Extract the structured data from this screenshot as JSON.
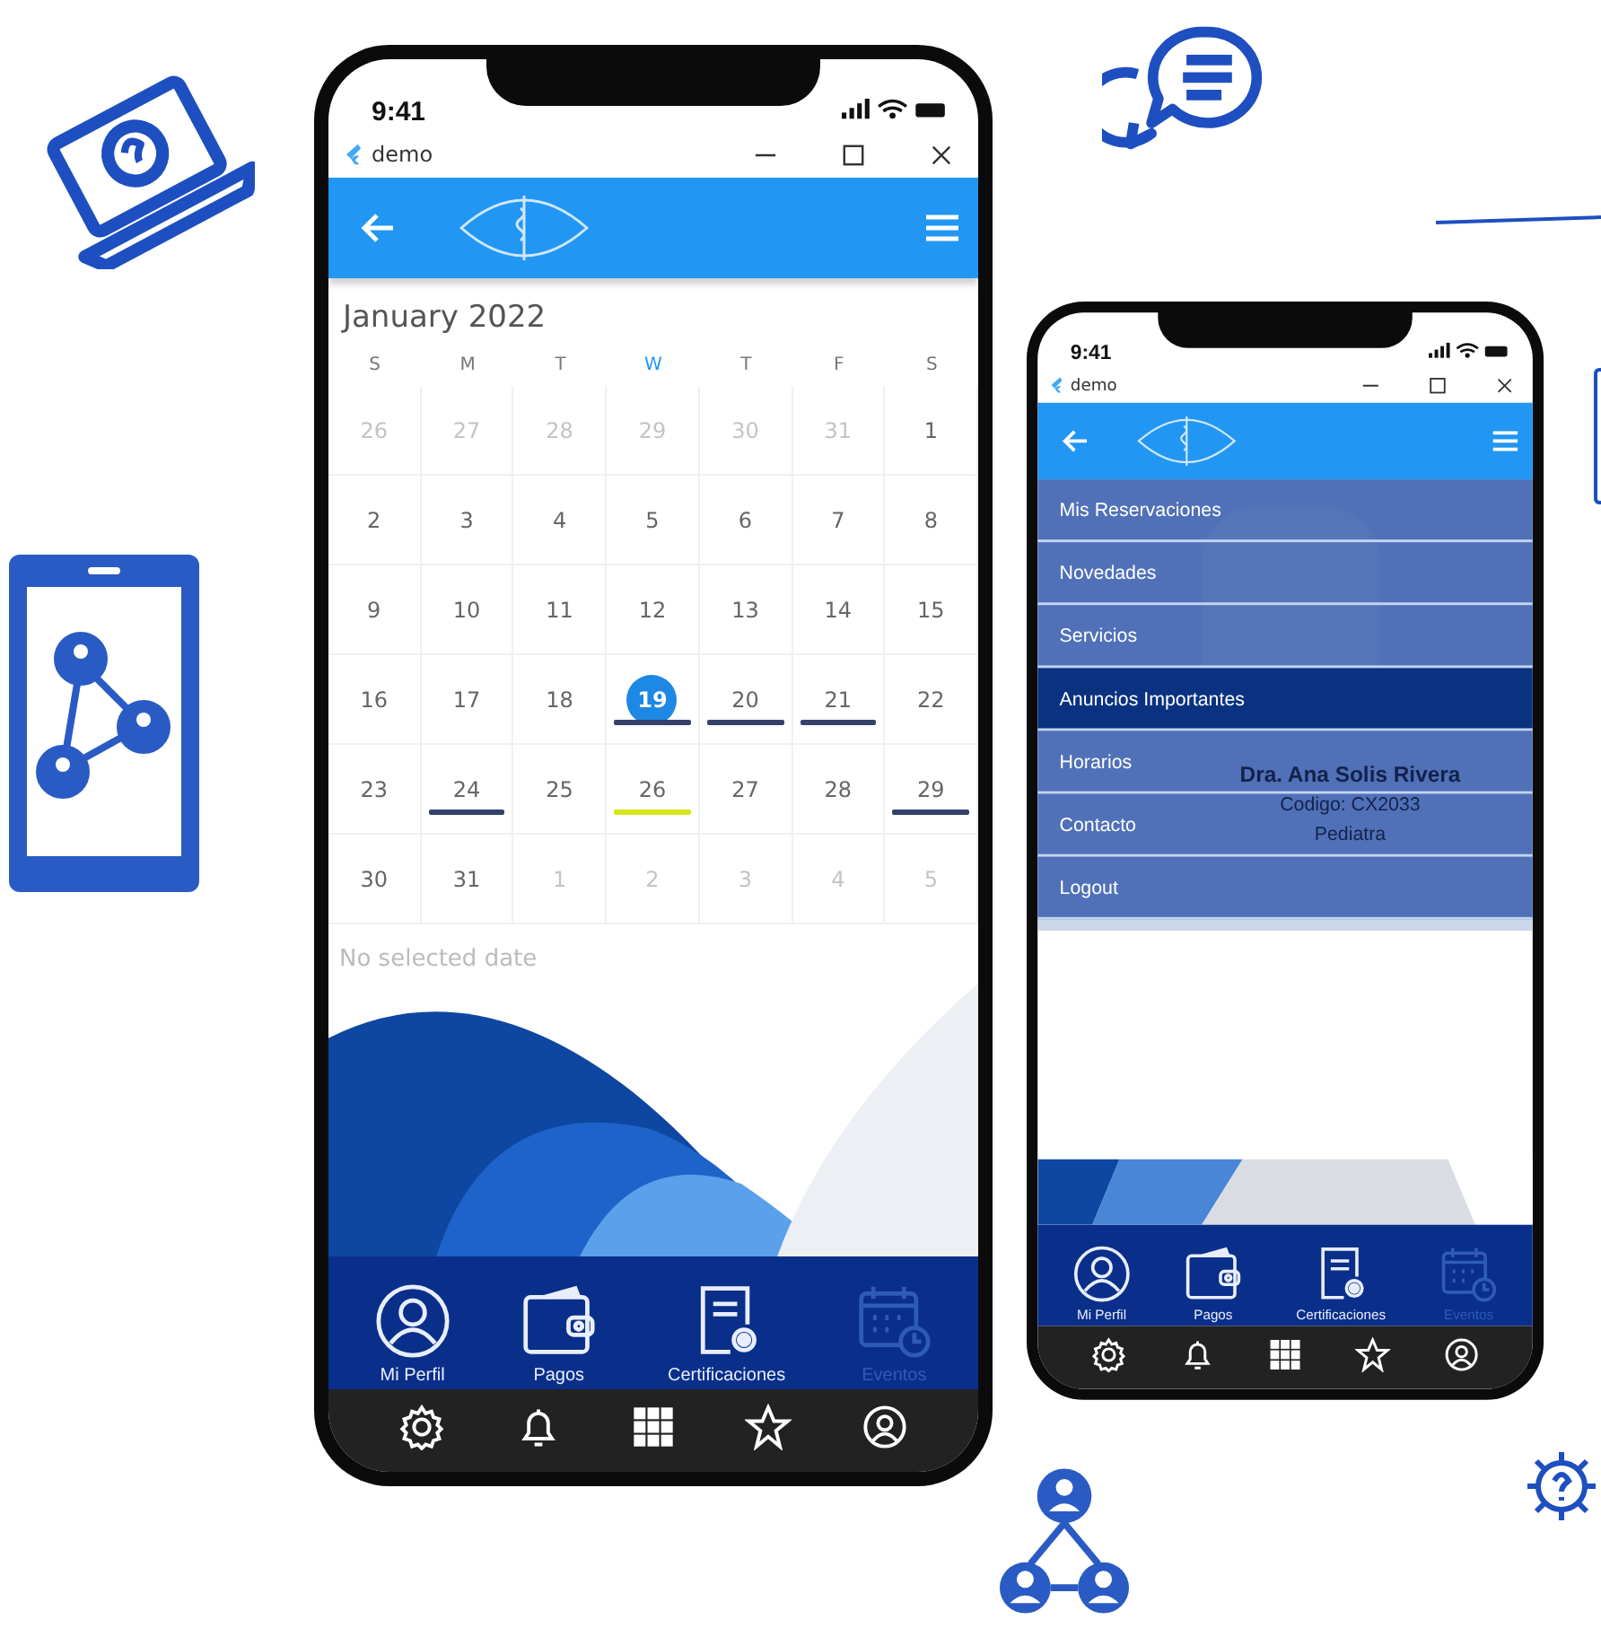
{
  "phones": [
    {
      "kind": "calendar",
      "status_time": "9:41",
      "window_title": "demo",
      "calendar": {
        "month_title": "January 2022",
        "weekdays": [
          {
            "label": "S",
            "today": false
          },
          {
            "label": "M",
            "today": false
          },
          {
            "label": "T",
            "today": false
          },
          {
            "label": "W",
            "today": true
          },
          {
            "label": "T",
            "today": false
          },
          {
            "label": "F",
            "today": false
          },
          {
            "label": "S",
            "today": false
          }
        ],
        "weeks": [
          [
            {
              "day": "26",
              "in_month": false,
              "selected": false
            },
            {
              "day": "27",
              "in_month": false,
              "selected": false
            },
            {
              "day": "28",
              "in_month": false,
              "selected": false
            },
            {
              "day": "29",
              "in_month": false,
              "selected": false
            },
            {
              "day": "30",
              "in_month": false,
              "selected": false
            },
            {
              "day": "31",
              "in_month": false,
              "selected": false
            },
            {
              "day": "1",
              "in_month": true,
              "selected": false
            }
          ],
          [
            {
              "day": "2",
              "in_month": true,
              "selected": false
            },
            {
              "day": "3",
              "in_month": true,
              "selected": false
            },
            {
              "day": "4",
              "in_month": true,
              "selected": false
            },
            {
              "day": "5",
              "in_month": true,
              "selected": false
            },
            {
              "day": "6",
              "in_month": true,
              "selected": false
            },
            {
              "day": "7",
              "in_month": true,
              "selected": false
            },
            {
              "day": "8",
              "in_month": true,
              "selected": false
            }
          ],
          [
            {
              "day": "9",
              "in_month": true,
              "selected": false
            },
            {
              "day": "10",
              "in_month": true,
              "selected": false
            },
            {
              "day": "11",
              "in_month": true,
              "selected": false
            },
            {
              "day": "12",
              "in_month": true,
              "selected": false
            },
            {
              "day": "13",
              "in_month": true,
              "selected": false
            },
            {
              "day": "14",
              "in_month": true,
              "selected": false
            },
            {
              "day": "15",
              "in_month": true,
              "selected": false
            }
          ],
          [
            {
              "day": "16",
              "in_month": true,
              "selected": false
            },
            {
              "day": "17",
              "in_month": true,
              "selected": false
            },
            {
              "day": "18",
              "in_month": true,
              "selected": false
            },
            {
              "day": "19",
              "in_month": true,
              "selected": true,
              "color": "#34416b"
            },
            {
              "day": "20",
              "in_month": true,
              "selected": false,
              "color": "#34416b"
            },
            {
              "day": "21",
              "in_month": true,
              "selected": false,
              "color": "#34416b"
            },
            {
              "day": "22",
              "in_month": true,
              "selected": false
            }
          ],
          [
            {
              "day": "23",
              "in_month": true,
              "selected": false
            },
            {
              "day": "24",
              "in_month": true,
              "selected": false,
              "color": "#34416b"
            },
            {
              "day": "25",
              "in_month": true,
              "selected": false
            },
            {
              "day": "26",
              "in_month": true,
              "selected": false,
              "color": "#d4e61b"
            },
            {
              "day": "27",
              "in_month": true,
              "selected": false
            },
            {
              "day": "28",
              "in_month": true,
              "selected": false
            },
            {
              "day": "29",
              "in_month": true,
              "selected": false,
              "color": "#34416b"
            }
          ],
          [
            {
              "day": "30",
              "in_month": true,
              "selected": false
            },
            {
              "day": "31",
              "in_month": true,
              "selected": false
            },
            {
              "day": "1",
              "in_month": false,
              "selected": false
            },
            {
              "day": "2",
              "in_month": false,
              "selected": false
            },
            {
              "day": "3",
              "in_month": false,
              "selected": false
            },
            {
              "day": "4",
              "in_month": false,
              "selected": false
            },
            {
              "day": "5",
              "in_month": false,
              "selected": false
            }
          ]
        ],
        "empty_message": "No selected date"
      },
      "bottom_tabs": [
        {
          "label": "Mi Perfil",
          "selected": false
        },
        {
          "label": "Pagos",
          "selected": false
        },
        {
          "label": "Certificaciones",
          "selected": false
        },
        {
          "label": "Eventos",
          "selected": true
        }
      ]
    },
    {
      "kind": "menu",
      "status_time": "9:41",
      "window_title": "demo",
      "menu": [
        {
          "label": "Mis Reservaciones",
          "selected": false
        },
        {
          "label": "Novedades",
          "selected": false
        },
        {
          "label": "Servicios",
          "selected": false
        },
        {
          "label": "Anuncios Importantes",
          "selected": true
        },
        {
          "label": "Horarios",
          "selected": false
        },
        {
          "label": "Contacto",
          "selected": false
        },
        {
          "label": "Logout",
          "selected": false
        }
      ],
      "profile": {
        "name": "Dra. Ana Solis Rivera",
        "code": "Codigo: CX2033",
        "specialty": "Pediatra"
      },
      "bottom_tabs": [
        {
          "label": "Mi Perfil",
          "selected": false
        },
        {
          "label": "Pagos",
          "selected": false
        },
        {
          "label": "Certificaciones",
          "selected": false
        },
        {
          "label": "Eventos",
          "selected": true
        }
      ]
    }
  ]
}
